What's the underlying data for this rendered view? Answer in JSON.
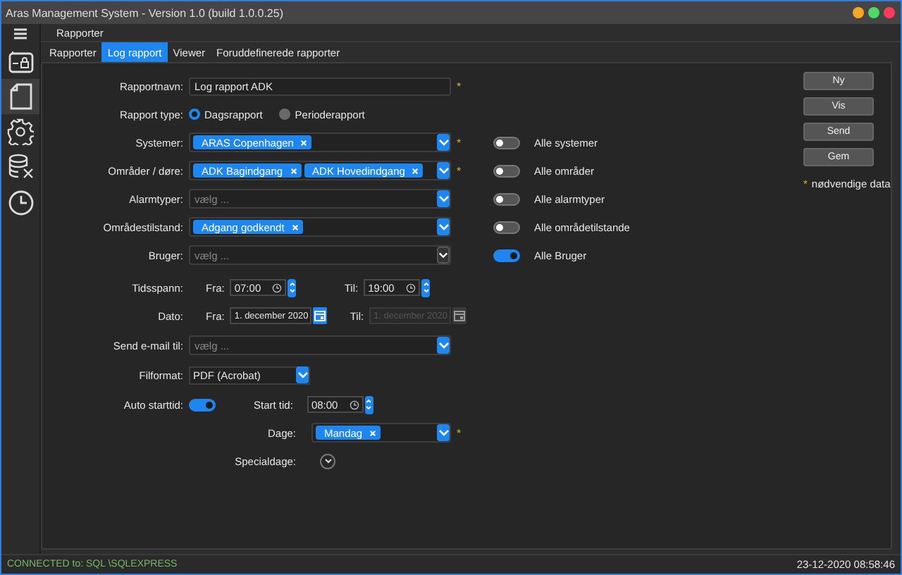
{
  "window": {
    "title": "Aras Management System - Version 1.0 (build 1.0.0.25)",
    "controls": [
      {
        "color": "#f5a623"
      },
      {
        "color": "#4cd964"
      },
      {
        "color": "#ff3b5c"
      }
    ]
  },
  "sidebar": {
    "items": [
      {
        "selected": false
      },
      {
        "selected": true
      },
      {
        "selected": false
      },
      {
        "selected": false
      },
      {
        "selected": false
      }
    ]
  },
  "header": "Rapporter",
  "tabs": [
    {
      "label": "Rapporter",
      "selected": false
    },
    {
      "label": "Log rapport",
      "selected": true
    },
    {
      "label": "Viewer",
      "selected": false
    },
    {
      "label": "Foruddefinerede rapporter",
      "selected": false
    }
  ],
  "form": {
    "required_mark": "*",
    "rows": [
      {
        "kind": "text",
        "label": "Rapportnavn:",
        "value": "Log rapport ADK",
        "required": true
      },
      {
        "kind": "radio",
        "label": "Rapport type:",
        "options": [
          {
            "label": "Dagsrapport",
            "selected": true
          },
          {
            "label": "Perioderapport",
            "selected": false
          }
        ]
      },
      {
        "kind": "multiselect",
        "label": "Systemer:",
        "tags": [
          "ARAS Copenhagen"
        ],
        "required": true,
        "disabled": false,
        "all_toggle": {
          "label": "Alle systemer",
          "on": false
        }
      },
      {
        "kind": "multiselect",
        "label": "Områder / døre:",
        "tags": [
          "ADK Bagindgang",
          "ADK Hovedindgang"
        ],
        "required": true,
        "disabled": false,
        "all_toggle": {
          "label": "Alle områder",
          "on": false
        }
      },
      {
        "kind": "multiselect",
        "label": "Alarmtyper:",
        "placeholder": "vælg ...",
        "required": false,
        "disabled": false,
        "all_toggle": {
          "label": "Alle alarmtyper",
          "on": false
        }
      },
      {
        "kind": "multiselect",
        "label": "Områdestilstand:",
        "tags": [
          "Adgang godkendt"
        ],
        "required": false,
        "disabled": false,
        "all_toggle": {
          "label": "Alle områdetilstande",
          "on": false
        }
      },
      {
        "kind": "multiselect",
        "label": "Bruger:",
        "placeholder": "vælg ...",
        "required": false,
        "disabled": true,
        "all_toggle": {
          "label": "Alle Bruger",
          "on": true
        }
      },
      {
        "kind": "timespan",
        "label": "Tidsspann:",
        "from": {
          "label": "Fra:",
          "value": "07:00"
        },
        "to": {
          "label": "Til:",
          "value": "19:00"
        }
      },
      {
        "kind": "daterange",
        "label": "Dato:",
        "from": {
          "label": "Fra:",
          "value": "1. december 2020",
          "disabled": false
        },
        "to": {
          "label": "Til:",
          "value": "1. december 2020",
          "disabled": true
        }
      },
      {
        "kind": "multiselect",
        "label": "Send e-mail til:",
        "placeholder": "vælg ...",
        "required": false,
        "disabled": false
      },
      {
        "kind": "select",
        "label": "Filformat:",
        "value": "PDF (Acrobat)"
      },
      {
        "kind": "autostart",
        "label": "Auto starttid:",
        "on": true,
        "start": {
          "label": "Start tid:",
          "value": "08:00"
        }
      },
      {
        "kind": "days",
        "label": "Dage:",
        "tags": [
          "Mandag"
        ],
        "required": true
      },
      {
        "kind": "special",
        "label": "Specialdage:"
      }
    ]
  },
  "buttons": [
    "Ny",
    "Vis",
    "Send",
    "Gem"
  ],
  "legend": {
    "mark": "*",
    "text": "nødvendige data"
  },
  "status_bar": {
    "connection": "CONNECTED to: SQL  \\SQLEXPRESS",
    "time": "23-12-2020 08:58:46"
  }
}
